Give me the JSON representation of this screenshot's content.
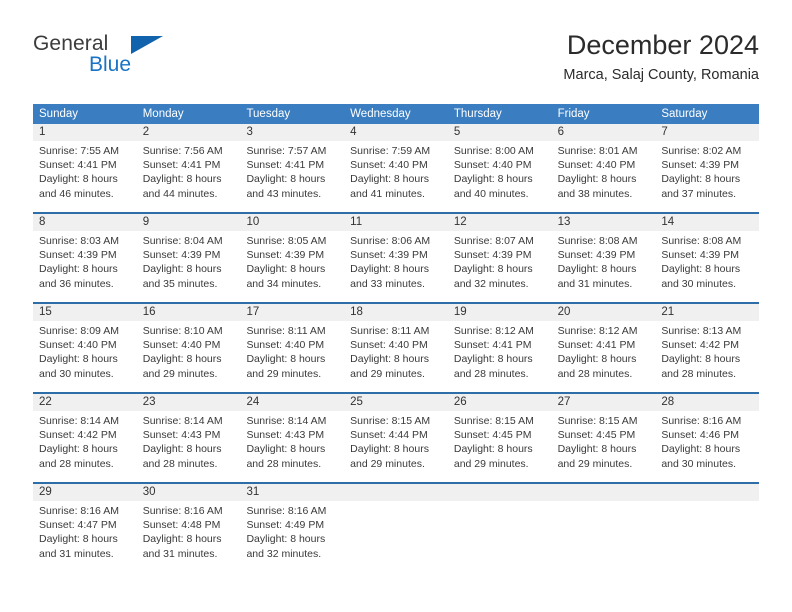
{
  "logo": {
    "word_one": "General",
    "word_two": "Blue",
    "triangle_icon": "triangle-icon"
  },
  "header": {
    "month_title": "December 2024",
    "location": "Marca, Salaj County, Romania"
  },
  "colors": {
    "header_blue": "#3a7dc0",
    "week_rule_blue": "#2e6da8",
    "day_strip_gray": "#f0f0f0",
    "logo_blue": "#1a73c4",
    "text": "#3a3a3a"
  },
  "weekday_headers": [
    "Sunday",
    "Monday",
    "Tuesday",
    "Wednesday",
    "Thursday",
    "Friday",
    "Saturday"
  ],
  "weeks": [
    [
      {
        "day": "1",
        "lines": [
          "Sunrise: 7:55 AM",
          "Sunset: 4:41 PM",
          "Daylight: 8 hours",
          "and 46 minutes."
        ]
      },
      {
        "day": "2",
        "lines": [
          "Sunrise: 7:56 AM",
          "Sunset: 4:41 PM",
          "Daylight: 8 hours",
          "and 44 minutes."
        ]
      },
      {
        "day": "3",
        "lines": [
          "Sunrise: 7:57 AM",
          "Sunset: 4:41 PM",
          "Daylight: 8 hours",
          "and 43 minutes."
        ]
      },
      {
        "day": "4",
        "lines": [
          "Sunrise: 7:59 AM",
          "Sunset: 4:40 PM",
          "Daylight: 8 hours",
          "and 41 minutes."
        ]
      },
      {
        "day": "5",
        "lines": [
          "Sunrise: 8:00 AM",
          "Sunset: 4:40 PM",
          "Daylight: 8 hours",
          "and 40 minutes."
        ]
      },
      {
        "day": "6",
        "lines": [
          "Sunrise: 8:01 AM",
          "Sunset: 4:40 PM",
          "Daylight: 8 hours",
          "and 38 minutes."
        ]
      },
      {
        "day": "7",
        "lines": [
          "Sunrise: 8:02 AM",
          "Sunset: 4:39 PM",
          "Daylight: 8 hours",
          "and 37 minutes."
        ]
      }
    ],
    [
      {
        "day": "8",
        "lines": [
          "Sunrise: 8:03 AM",
          "Sunset: 4:39 PM",
          "Daylight: 8 hours",
          "and 36 minutes."
        ]
      },
      {
        "day": "9",
        "lines": [
          "Sunrise: 8:04 AM",
          "Sunset: 4:39 PM",
          "Daylight: 8 hours",
          "and 35 minutes."
        ]
      },
      {
        "day": "10",
        "lines": [
          "Sunrise: 8:05 AM",
          "Sunset: 4:39 PM",
          "Daylight: 8 hours",
          "and 34 minutes."
        ]
      },
      {
        "day": "11",
        "lines": [
          "Sunrise: 8:06 AM",
          "Sunset: 4:39 PM",
          "Daylight: 8 hours",
          "and 33 minutes."
        ]
      },
      {
        "day": "12",
        "lines": [
          "Sunrise: 8:07 AM",
          "Sunset: 4:39 PM",
          "Daylight: 8 hours",
          "and 32 minutes."
        ]
      },
      {
        "day": "13",
        "lines": [
          "Sunrise: 8:08 AM",
          "Sunset: 4:39 PM",
          "Daylight: 8 hours",
          "and 31 minutes."
        ]
      },
      {
        "day": "14",
        "lines": [
          "Sunrise: 8:08 AM",
          "Sunset: 4:39 PM",
          "Daylight: 8 hours",
          "and 30 minutes."
        ]
      }
    ],
    [
      {
        "day": "15",
        "lines": [
          "Sunrise: 8:09 AM",
          "Sunset: 4:40 PM",
          "Daylight: 8 hours",
          "and 30 minutes."
        ]
      },
      {
        "day": "16",
        "lines": [
          "Sunrise: 8:10 AM",
          "Sunset: 4:40 PM",
          "Daylight: 8 hours",
          "and 29 minutes."
        ]
      },
      {
        "day": "17",
        "lines": [
          "Sunrise: 8:11 AM",
          "Sunset: 4:40 PM",
          "Daylight: 8 hours",
          "and 29 minutes."
        ]
      },
      {
        "day": "18",
        "lines": [
          "Sunrise: 8:11 AM",
          "Sunset: 4:40 PM",
          "Daylight: 8 hours",
          "and 29 minutes."
        ]
      },
      {
        "day": "19",
        "lines": [
          "Sunrise: 8:12 AM",
          "Sunset: 4:41 PM",
          "Daylight: 8 hours",
          "and 28 minutes."
        ]
      },
      {
        "day": "20",
        "lines": [
          "Sunrise: 8:12 AM",
          "Sunset: 4:41 PM",
          "Daylight: 8 hours",
          "and 28 minutes."
        ]
      },
      {
        "day": "21",
        "lines": [
          "Sunrise: 8:13 AM",
          "Sunset: 4:42 PM",
          "Daylight: 8 hours",
          "and 28 minutes."
        ]
      }
    ],
    [
      {
        "day": "22",
        "lines": [
          "Sunrise: 8:14 AM",
          "Sunset: 4:42 PM",
          "Daylight: 8 hours",
          "and 28 minutes."
        ]
      },
      {
        "day": "23",
        "lines": [
          "Sunrise: 8:14 AM",
          "Sunset: 4:43 PM",
          "Daylight: 8 hours",
          "and 28 minutes."
        ]
      },
      {
        "day": "24",
        "lines": [
          "Sunrise: 8:14 AM",
          "Sunset: 4:43 PM",
          "Daylight: 8 hours",
          "and 28 minutes."
        ]
      },
      {
        "day": "25",
        "lines": [
          "Sunrise: 8:15 AM",
          "Sunset: 4:44 PM",
          "Daylight: 8 hours",
          "and 29 minutes."
        ]
      },
      {
        "day": "26",
        "lines": [
          "Sunrise: 8:15 AM",
          "Sunset: 4:45 PM",
          "Daylight: 8 hours",
          "and 29 minutes."
        ]
      },
      {
        "day": "27",
        "lines": [
          "Sunrise: 8:15 AM",
          "Sunset: 4:45 PM",
          "Daylight: 8 hours",
          "and 29 minutes."
        ]
      },
      {
        "day": "28",
        "lines": [
          "Sunrise: 8:16 AM",
          "Sunset: 4:46 PM",
          "Daylight: 8 hours",
          "and 30 minutes."
        ]
      }
    ],
    [
      {
        "day": "29",
        "lines": [
          "Sunrise: 8:16 AM",
          "Sunset: 4:47 PM",
          "Daylight: 8 hours",
          "and 31 minutes."
        ]
      },
      {
        "day": "30",
        "lines": [
          "Sunrise: 8:16 AM",
          "Sunset: 4:48 PM",
          "Daylight: 8 hours",
          "and 31 minutes."
        ]
      },
      {
        "day": "31",
        "lines": [
          "Sunrise: 8:16 AM",
          "Sunset: 4:49 PM",
          "Daylight: 8 hours",
          "and 32 minutes."
        ]
      },
      {
        "day": "",
        "lines": []
      },
      {
        "day": "",
        "lines": []
      },
      {
        "day": "",
        "lines": []
      },
      {
        "day": "",
        "lines": []
      }
    ]
  ]
}
